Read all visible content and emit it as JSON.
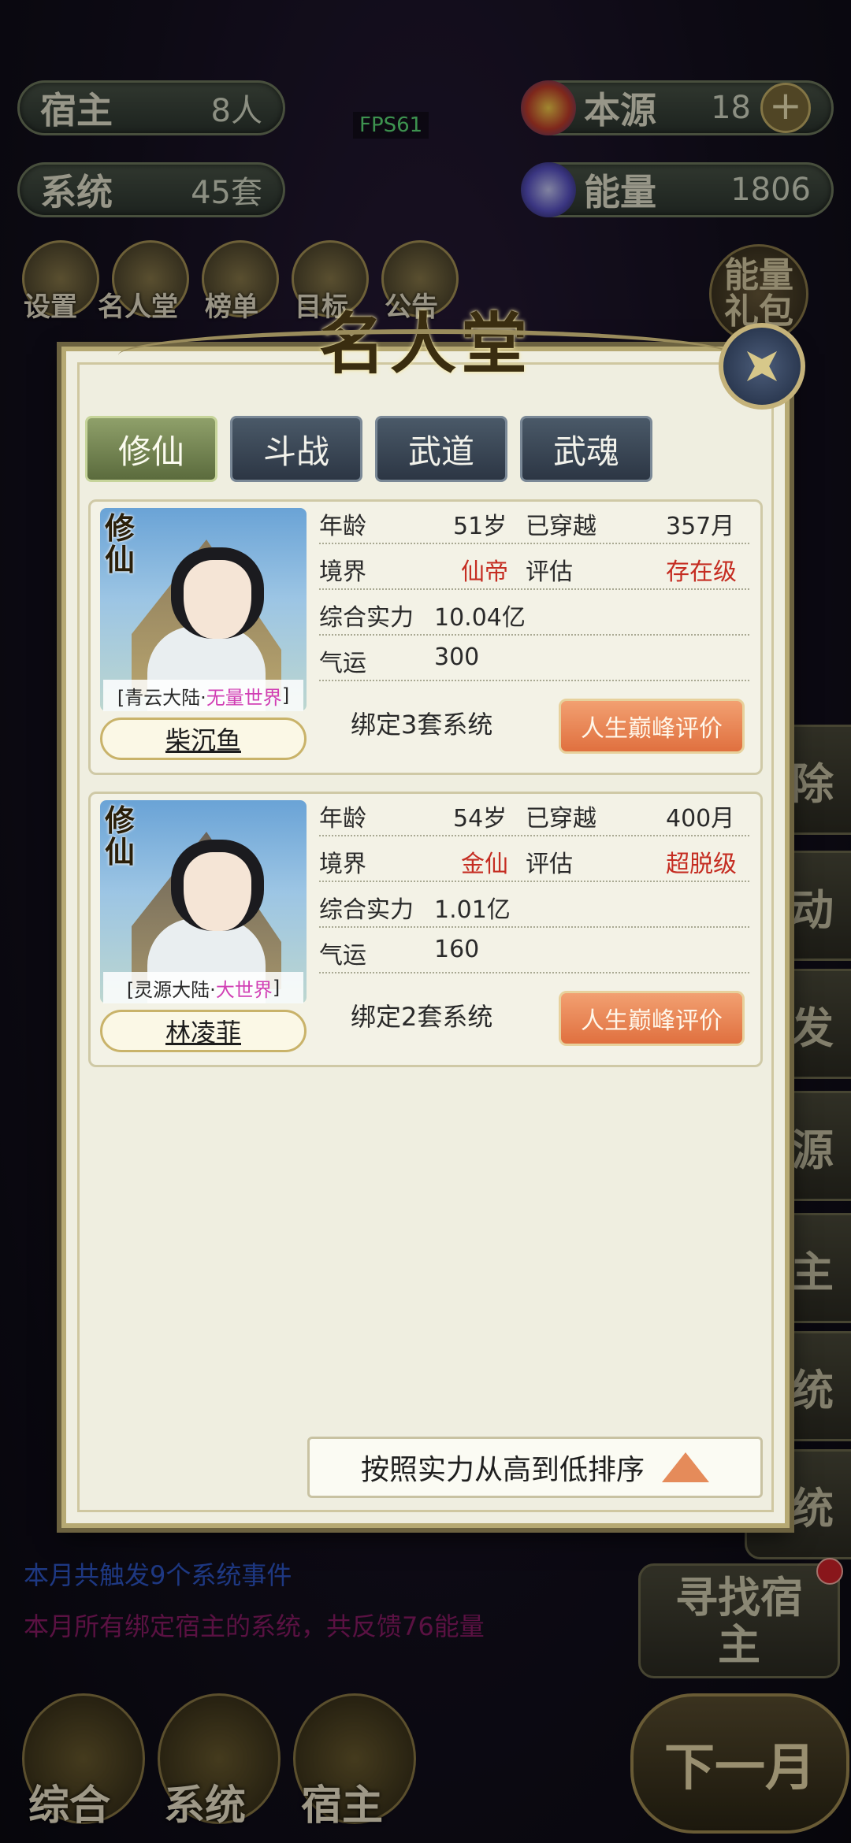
{
  "hud": {
    "host_label": "宿主",
    "host_value": "8人",
    "system_label": "系统",
    "system_value": "45套",
    "source_label": "本源",
    "source_value": "18",
    "energy_label": "能量",
    "energy_value": "1806",
    "fps": "FPS61"
  },
  "top_icons": [
    "设置",
    "名人堂",
    "榜单",
    "目标",
    "公告"
  ],
  "energy_gift_label": "能量礼包",
  "side_buttons": [
    "除",
    "动",
    "发",
    "源",
    "主",
    "统",
    "统"
  ],
  "find_host_label": "寻找宿主",
  "bottom_logs": [
    {
      "text": "本月共触发9个系统事件",
      "color": "#2e57c8"
    },
    {
      "text": "本月所有绑定宿主的系统，共反馈76能量",
      "color": "#8a1b66"
    }
  ],
  "bottom_nav": [
    "综合",
    "系统",
    "宿主"
  ],
  "next_month_label": "下一月",
  "modal": {
    "title": "名人堂",
    "tabs": [
      "修仙",
      "斗战",
      "武道",
      "武魂"
    ],
    "active_tab": 0,
    "cards": [
      {
        "category": "修仙",
        "world_prefix": "[青云大陆·",
        "world_highlight": "无量世界",
        "world_suffix": "]",
        "name": "柴沉鱼",
        "age_label": "年龄",
        "age": "51岁",
        "traveled_label": "已穿越",
        "traveled": "357月",
        "realm_label": "境界",
        "realm": "仙帝",
        "eval_label": "评估",
        "eval": "存在级",
        "power_label": "综合实力",
        "power": "10.04亿",
        "luck_label": "气运",
        "luck": "300",
        "bind_text": "绑定3套系统",
        "peak_btn": "人生巅峰评价"
      },
      {
        "category": "修仙",
        "world_prefix": "[灵源大陆·",
        "world_highlight": "大世界",
        "world_suffix": "]",
        "name": "林凌菲",
        "age_label": "年龄",
        "age": "54岁",
        "traveled_label": "已穿越",
        "traveled": "400月",
        "realm_label": "境界",
        "realm": "金仙",
        "eval_label": "评估",
        "eval": "超脱级",
        "power_label": "综合实力",
        "power": "1.01亿",
        "luck_label": "气运",
        "luck": "160",
        "bind_text": "绑定2套系统",
        "peak_btn": "人生巅峰评价"
      }
    ],
    "sort_label": "按照实力从高到低排序"
  }
}
